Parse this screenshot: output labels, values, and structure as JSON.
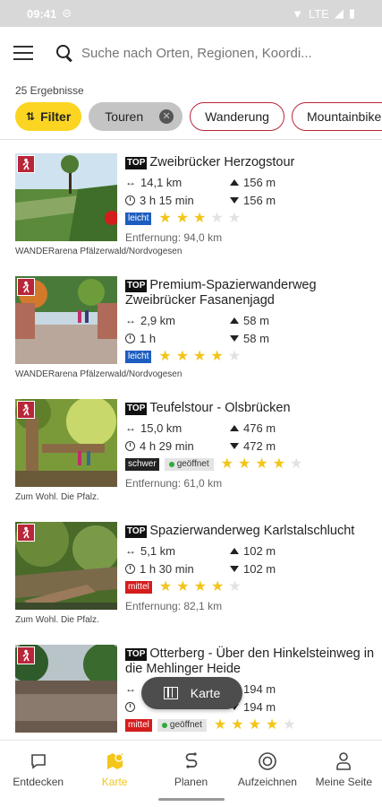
{
  "status": {
    "time": "09:41",
    "network": "LTE"
  },
  "search": {
    "placeholder": "Suche nach Orten, Regionen, Koordi..."
  },
  "results": {
    "count_label": "25 Ergebnisse"
  },
  "chips": [
    {
      "label": "Filter"
    },
    {
      "label": "Touren"
    },
    {
      "label": "Wanderung"
    },
    {
      "label": "Mountainbike"
    }
  ],
  "colors": {
    "accent": "#fbd521",
    "brand_red": "#b8263a",
    "leicht": "#1d5dbf",
    "mittel": "#d41c1c",
    "schwer": "#222222"
  },
  "tours": [
    {
      "badge": "TOP",
      "title": "Zweibrücker Herzogstour",
      "distance": "14,1 km",
      "duration": "3 h 15 min",
      "ascent": "156 m",
      "descent": "156 m",
      "difficulty": "leicht",
      "open": "",
      "rating": 3,
      "entfernung": "Entfernung: 94,0 km",
      "provider": "WANDERarena Pfälzerwald/Nordvogesen",
      "icon": "hiking-icon"
    },
    {
      "badge": "TOP",
      "title": "Premium-Spazierwanderweg Zweibrücker Fasanenjagd",
      "distance": "2,9 km",
      "duration": "1 h",
      "ascent": "58 m",
      "descent": "58 m",
      "difficulty": "leicht",
      "open": "",
      "rating": 4,
      "entfernung": "",
      "provider": "WANDERarena Pfälzerwald/Nordvogesen",
      "icon": "hiking-icon"
    },
    {
      "badge": "TOP",
      "title": "Teufelstour - Olsbrücken",
      "distance": "15,0 km",
      "duration": "4 h 29 min",
      "ascent": "476 m",
      "descent": "472 m",
      "difficulty": "schwer",
      "open": "geöffnet",
      "rating": 4,
      "entfernung": "Entfernung: 61,0 km",
      "provider": "Zum Wohl. Die Pfalz.",
      "icon": "hiking-icon"
    },
    {
      "badge": "TOP",
      "title": "Spazierwanderweg Karlstalschlucht",
      "distance": "5,1 km",
      "duration": "1 h 30 min",
      "ascent": "102 m",
      "descent": "102 m",
      "difficulty": "mittel",
      "open": "",
      "rating": 4,
      "entfernung": "Entfernung: 82,1 km",
      "provider": "Zum Wohl. Die Pfalz.",
      "icon": "hiking-icon"
    },
    {
      "badge": "TOP",
      "title": "Otterberg - Über den Hinkelsteinweg in die Mehlinger Heide",
      "distance": "",
      "duration": "",
      "ascent": "194 m",
      "descent": "194 m",
      "difficulty": "mittel",
      "open": "geöffnet",
      "rating": 4,
      "entfernung": "",
      "provider": "",
      "icon": "hiking-icon"
    }
  ],
  "fab": {
    "label": "Karte"
  },
  "nav": [
    {
      "label": "Entdecken",
      "icon": "chat-icon"
    },
    {
      "label": "Karte",
      "icon": "map-icon",
      "active": true
    },
    {
      "label": "Planen",
      "icon": "route-icon"
    },
    {
      "label": "Aufzeichnen",
      "icon": "record-icon"
    },
    {
      "label": "Meine Seite",
      "icon": "profile-icon"
    }
  ]
}
